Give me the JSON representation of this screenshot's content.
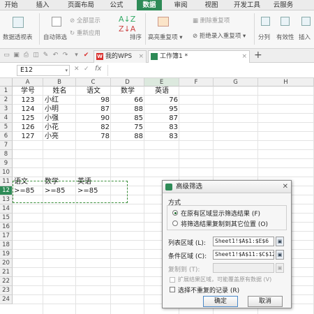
{
  "ribbon_tabs": [
    "开始",
    "插入",
    "页面布局",
    "公式",
    "数据",
    "审阅",
    "视图",
    "开发工具",
    "云服务"
  ],
  "active_tab": "数据",
  "ribbon": {
    "pivot": "数据透视表",
    "autofilter": "自动筛选",
    "show_all": "全部显示",
    "reapply": "重新应用",
    "sort": "排序",
    "highlight_dup": "高亮重复项",
    "remove_dup": "删除重复项",
    "reject_dup": "拒绝录入重复项",
    "split": "分列",
    "validity": "有效性",
    "insert": "插入"
  },
  "doc_tabs": [
    {
      "label": "我的WPS",
      "logo": "W"
    },
    {
      "label": "工作簿1 *"
    }
  ],
  "new_tab": "+",
  "formula_bar": {
    "cell_ref": "E12",
    "fx": "fx",
    "cancel": "✕",
    "confirm": "✓"
  },
  "columns": [
    "A",
    "B",
    "C",
    "D",
    "E",
    "F",
    "G",
    "H"
  ],
  "rows": [
    "1",
    "2",
    "3",
    "4",
    "5",
    "6",
    "7",
    "8",
    "9",
    "10",
    "11",
    "12",
    "13",
    "14",
    "15",
    "16",
    "17",
    "18",
    "19",
    "20",
    "21",
    "22",
    "23",
    "24"
  ],
  "selected_col": "E",
  "selected_row": "12",
  "table": {
    "headers": [
      "学号",
      "姓名",
      "语文",
      "数学",
      "英语"
    ],
    "records": [
      [
        "123",
        "小红",
        "98",
        "66",
        "76"
      ],
      [
        "124",
        "小明",
        "87",
        "88",
        "95"
      ],
      [
        "125",
        "小强",
        "90",
        "85",
        "87"
      ],
      [
        "126",
        "小花",
        "82",
        "75",
        "83"
      ],
      [
        "127",
        "小亮",
        "78",
        "88",
        "83"
      ]
    ]
  },
  "criteria": {
    "headers": [
      "语文",
      "数学",
      "英语"
    ],
    "values": [
      ">=85",
      ">=85",
      ">=85"
    ]
  },
  "dialog": {
    "title": "高级筛选",
    "method_label": "方式",
    "option_inplace": "在原有区域显示筛选结果 (F)",
    "option_copy": "将筛选结果复制到其它位置 (O)",
    "list_range_label": "列表区域 (L):",
    "list_range_value": "Sheet1!$A$1:$E$6",
    "criteria_range_label": "条件区域 (C):",
    "criteria_range_value": "Sheet1!$A$11:$C$12",
    "copy_to_label": "复制到 (T):",
    "expand_label": "扩展结果区域，可能覆盖原有数据 (V)",
    "unique_label": "选择不重复的记录 (R)",
    "ok": "确定",
    "cancel": "取消"
  }
}
